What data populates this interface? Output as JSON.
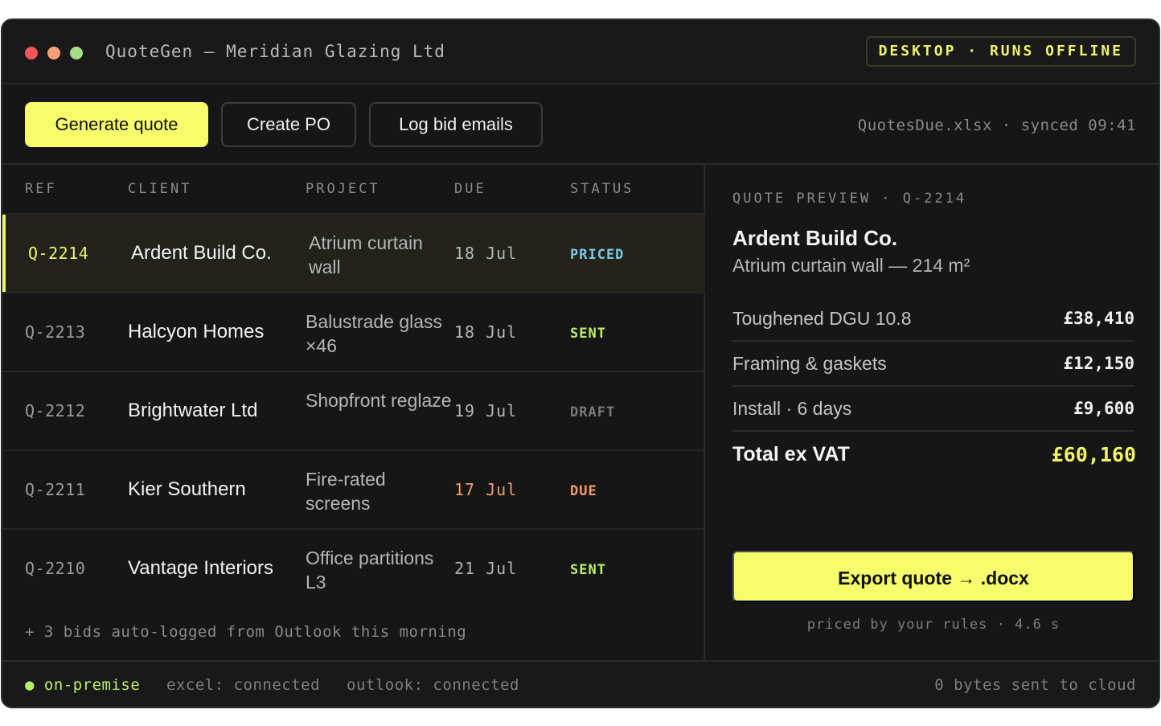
{
  "window": {
    "title": "QuoteGen — Meridian Glazing Ltd",
    "mode_badge": "DESKTOP · RUNS OFFLINE",
    "traffic_lights": [
      "#f0575a",
      "#f5a07a",
      "#a8dc8a"
    ]
  },
  "toolbar": {
    "generate_label": "Generate quote",
    "create_po_label": "Create PO",
    "log_bids_label": "Log bid emails",
    "sync_info": "QuotesDue.xlsx · synced 09:41"
  },
  "table": {
    "headers": [
      "REF",
      "CLIENT",
      "PROJECT",
      "DUE",
      "STATUS"
    ],
    "rows": [
      {
        "ref": "Q-2214",
        "client": "Ardent Build Co.",
        "project": "Atrium curtain wall",
        "due": "18 Jul",
        "status": "PRICED",
        "status_color": "#7ec8e3",
        "due_color": "#b5b5b5",
        "selected": true
      },
      {
        "ref": "Q-2213",
        "client": "Halcyon Homes",
        "project": "Balustrade glass ×46",
        "due": "18 Jul",
        "status": "SENT",
        "status_color": "#b9f06a",
        "due_color": "#b5b5b5",
        "selected": false
      },
      {
        "ref": "Q-2212",
        "client": "Brightwater Ltd",
        "project": "Shopfront reglaze",
        "due": "19 Jul",
        "status": "DRAFT",
        "status_color": "#7a7a7a",
        "due_color": "#b5b5b5",
        "selected": false
      },
      {
        "ref": "Q-2211",
        "client": "Kier Southern",
        "project": "Fire-rated screens",
        "due": "17 Jul",
        "status": "DUE",
        "status_color": "#f59a6a",
        "due_color": "#f59a6a",
        "selected": false
      },
      {
        "ref": "Q-2210",
        "client": "Vantage Interiors",
        "project": "Office partitions L3",
        "due": "21 Jul",
        "status": "SENT",
        "status_color": "#b9f06a",
        "due_color": "#b5b5b5",
        "selected": false
      }
    ],
    "footnote": "+ 3 bids auto-logged from Outlook this morning"
  },
  "preview": {
    "heading": "QUOTE PREVIEW · Q-2214",
    "client": "Ardent Build Co.",
    "project": "Atrium curtain wall — 214 m²",
    "line_items": [
      {
        "label": "Toughened DGU 10.8",
        "amount": "£38,410"
      },
      {
        "label": "Framing & gaskets",
        "amount": "£12,150"
      },
      {
        "label": "Install · 6 days",
        "amount": "£9,600"
      }
    ],
    "total_label": "Total ex VAT",
    "total_amount": "£60,160",
    "export_label": "Export quote → .docx",
    "note": "priced by your rules · 4.6 s"
  },
  "statusbar": {
    "on_premise": "● on-premise",
    "excel": "excel: connected",
    "outlook": "outlook: connected",
    "cloud": "0 bytes sent to cloud"
  },
  "colors": {
    "accent": "#f7fc6a",
    "background": "#161616"
  }
}
